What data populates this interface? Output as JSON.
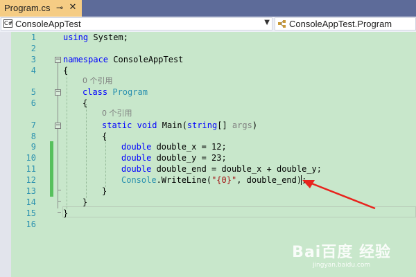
{
  "tab": {
    "title": "Program.cs",
    "pin_icon": "pin-icon",
    "close_icon": "close-icon"
  },
  "navigation": {
    "project": "ConsoleAppTest",
    "project_icon": "csharp-file-icon",
    "class": "ConsoleAppTest.Program",
    "class_icon": "class-icon"
  },
  "editor": {
    "line_numbers": [
      "1",
      "2",
      "3",
      "4",
      "5",
      "6",
      "7",
      "8",
      "9",
      "10",
      "11",
      "12",
      "13",
      "14",
      "15",
      "16"
    ],
    "reference_hint": "0 个引用",
    "tokens": {
      "using": "using",
      "system": " System;",
      "namespace": "namespace",
      "ns_name": " ConsoleAppTest",
      "open_brace": "{",
      "close_brace": "}",
      "class_kw": "class",
      "class_name": "Program",
      "static": "static",
      "void": "void",
      "main": "Main",
      "string": "string",
      "args_open": "(",
      "args_mid": "[] ",
      "args": "args",
      "args_close": ")",
      "double": "double",
      "line9_rest": " double_x = 12;",
      "line10_rest": " double_y = 23;",
      "line11_rest": " double_end = double_x + double_y;",
      "console": "Console",
      "writeline": ".WriteLine(",
      "format_string": "\"{0}\"",
      "line12_rest": ", double_end);"
    }
  },
  "annotation": {
    "arrow_color": "#e8231d"
  },
  "watermark": {
    "logo": "Bai百度 经验",
    "url": "jingyan.baidu.com"
  }
}
